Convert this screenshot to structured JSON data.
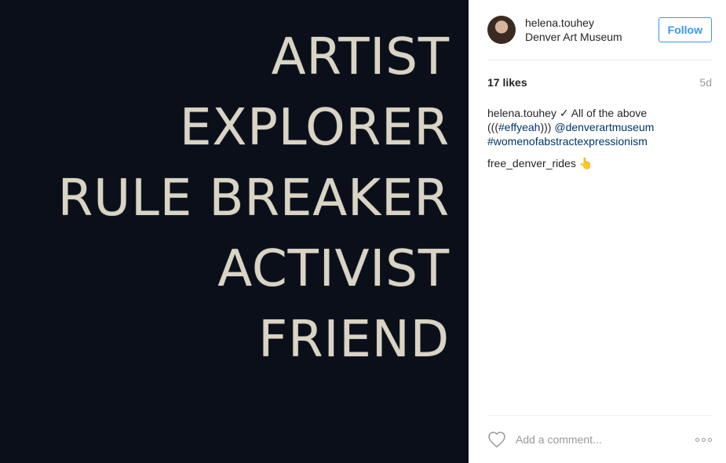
{
  "photo": {
    "lines": [
      "ARTIST",
      "EXPLORER",
      "RULE BREAKER",
      "ACTIVIST",
      "FRIEND"
    ]
  },
  "header": {
    "username": "helena.touhey",
    "location": "Denver Art Museum",
    "follow_label": "Follow"
  },
  "stats": {
    "likes": "17 likes",
    "age": "5d"
  },
  "caption": {
    "username": "helena.touhey",
    "text_part1": "✓ All of the above (((",
    "hashtag1": "#effyeah",
    "text_part2": ")))",
    "mention": "@denverartmuseum",
    "hashtag2": "#womenofabstractexpressionism"
  },
  "comments": [
    {
      "username": "free_denver_rides",
      "text": "👆"
    }
  ],
  "footer": {
    "comment_placeholder": "Add a comment..."
  },
  "colors": {
    "accent": "#3897f0",
    "link": "#003569",
    "photo_bg": "#0b0f19",
    "photo_text": "#d9d4c4"
  }
}
